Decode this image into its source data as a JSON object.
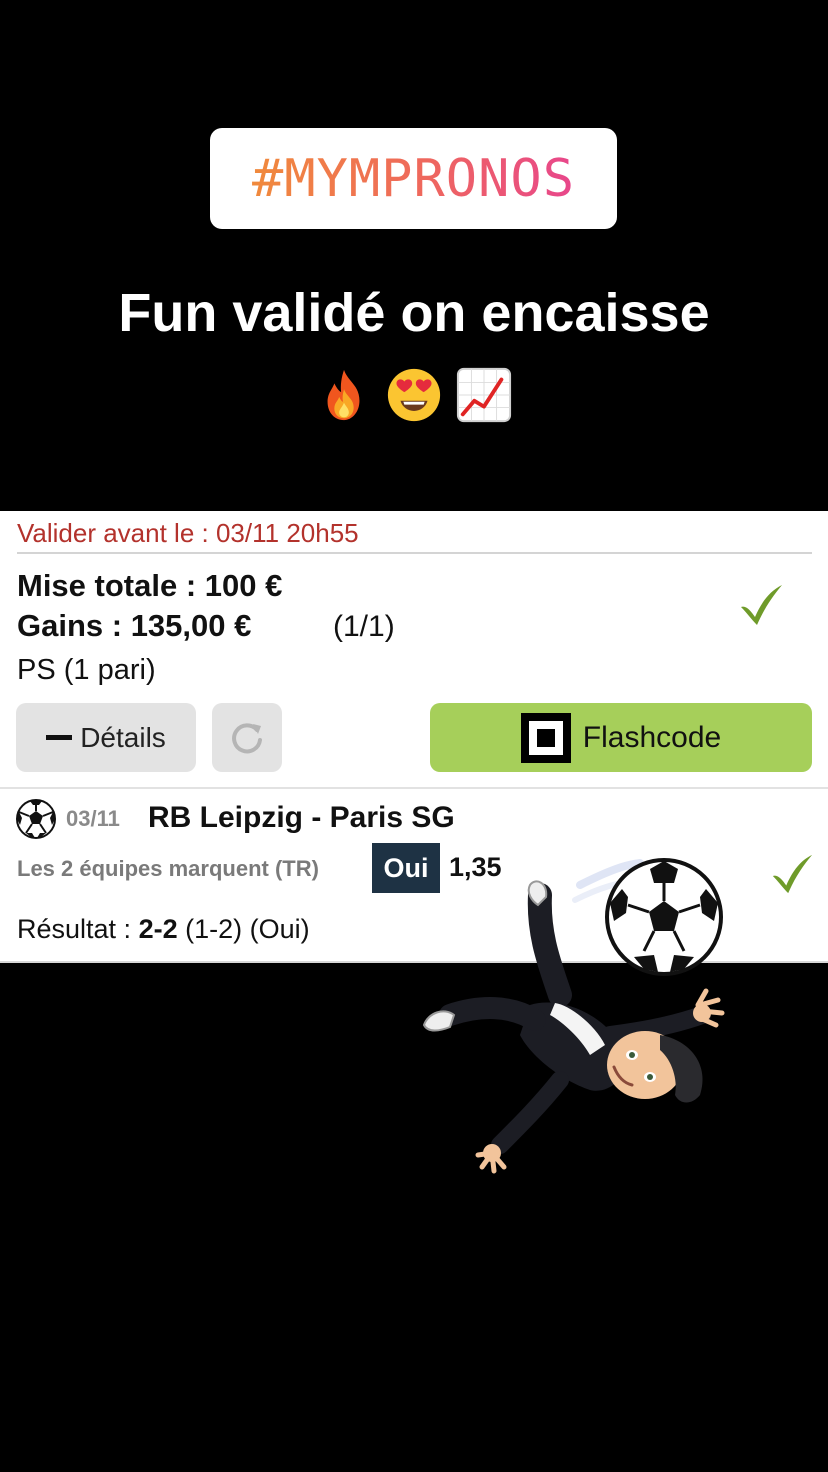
{
  "story": {
    "hashtag": "#MYMPRONOS",
    "caption": "Fun validé on encaisse"
  },
  "emojis": [
    "fire-emoji",
    "heart-eyes-emoji",
    "chart-increasing-emoji"
  ],
  "ticket": {
    "deadline": "Valider avant le : 03/11 20h55",
    "stake": "Mise totale : 100 €",
    "gains": "Gains : 135,00 €",
    "count": "(1/1)",
    "bet_type": "PS (1 pari)",
    "details_label": "Détails",
    "flashcode_label": "Flashcode",
    "status_color": "#6f9b2a"
  },
  "match": {
    "date": "03/11",
    "title": "RB Leipzig - Paris SG",
    "market": "Les 2 équipes marquent (TR)",
    "choice": "Oui",
    "odds": "1,35",
    "result_label": "Résultat : ",
    "result_score": "2-2",
    "result_detail": " (1-2) (Oui)"
  },
  "colors": {
    "deadline": "#b3322c",
    "flashcode_bg": "#a6cf5a",
    "choice_bg": "#1e3244"
  }
}
